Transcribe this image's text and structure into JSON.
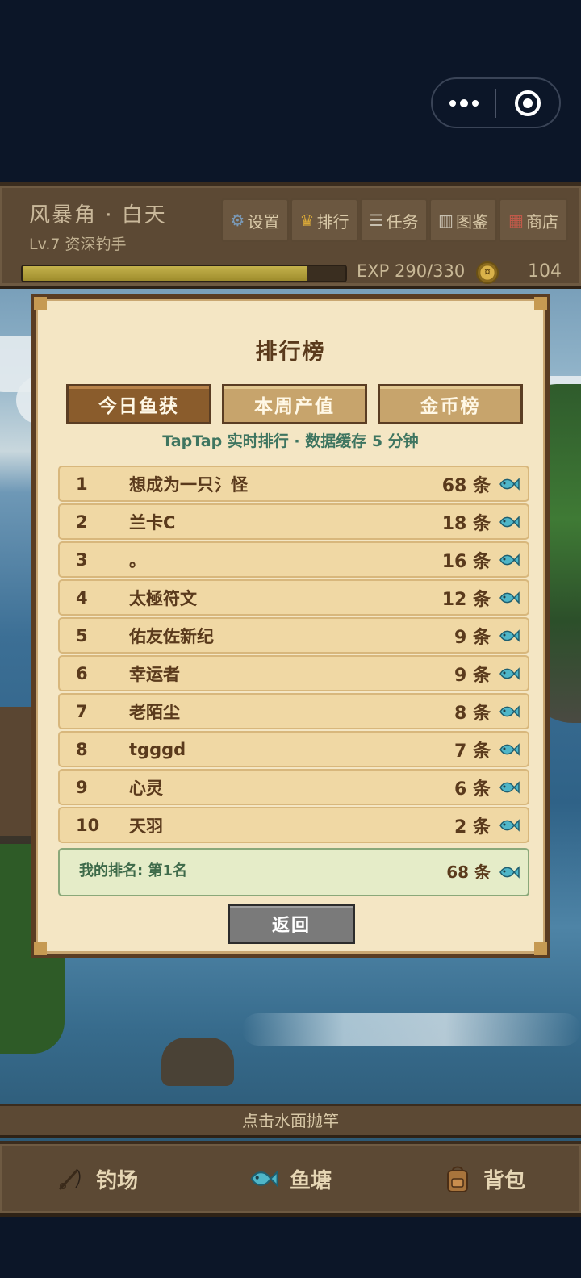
{
  "hud": {
    "location": "风暴角 · 白天",
    "level": "Lv.7 资深钓手",
    "buttons": [
      {
        "icon": "gear-icon",
        "label": "设置"
      },
      {
        "icon": "crown-icon",
        "label": "排行"
      },
      {
        "icon": "scroll-icon",
        "label": "任务"
      },
      {
        "icon": "book-icon",
        "label": "图鉴"
      },
      {
        "icon": "shop-icon",
        "label": "商店"
      }
    ],
    "exp_text": "EXP 290/330",
    "exp_fraction": 0.88,
    "gold": "104"
  },
  "leaderboard": {
    "title": "排行榜",
    "tabs": [
      "今日鱼获",
      "本周产值",
      "金币榜"
    ],
    "active_tab": 0,
    "subtitle": "TapTap 实时排行 · 数据缓存 5 分钟",
    "rows": [
      {
        "rank": "1",
        "name": "想成为一只氵怪",
        "count": "68 条"
      },
      {
        "rank": "2",
        "name": "兰卡C",
        "count": "18 条"
      },
      {
        "rank": "3",
        "name": "。",
        "count": "16 条"
      },
      {
        "rank": "4",
        "name": "太極符文",
        "count": "12 条"
      },
      {
        "rank": "5",
        "name": "佑友佐新纪",
        "count": "9 条"
      },
      {
        "rank": "6",
        "name": "幸运者",
        "count": "9 条"
      },
      {
        "rank": "7",
        "name": "老陌尘",
        "count": "8 条"
      },
      {
        "rank": "8",
        "name": "tgggd",
        "count": "7 条"
      },
      {
        "rank": "9",
        "name": "心灵",
        "count": "6 条"
      },
      {
        "rank": "10",
        "name": "天羽",
        "count": "2 条"
      }
    ],
    "my_rank_label": "我的排名: 第1名",
    "my_count": "68 条",
    "back_label": "返回"
  },
  "hint": "点击水面抛竿",
  "nav": [
    {
      "icon": "fishing-rod-icon",
      "label": "钓场"
    },
    {
      "icon": "fish-icon",
      "label": "鱼塘"
    },
    {
      "icon": "backpack-icon",
      "label": "背包"
    }
  ],
  "colors": {
    "fish_accent": "#4fb6c8",
    "panel": "#f4e6c4",
    "wood": "#5c4934"
  }
}
